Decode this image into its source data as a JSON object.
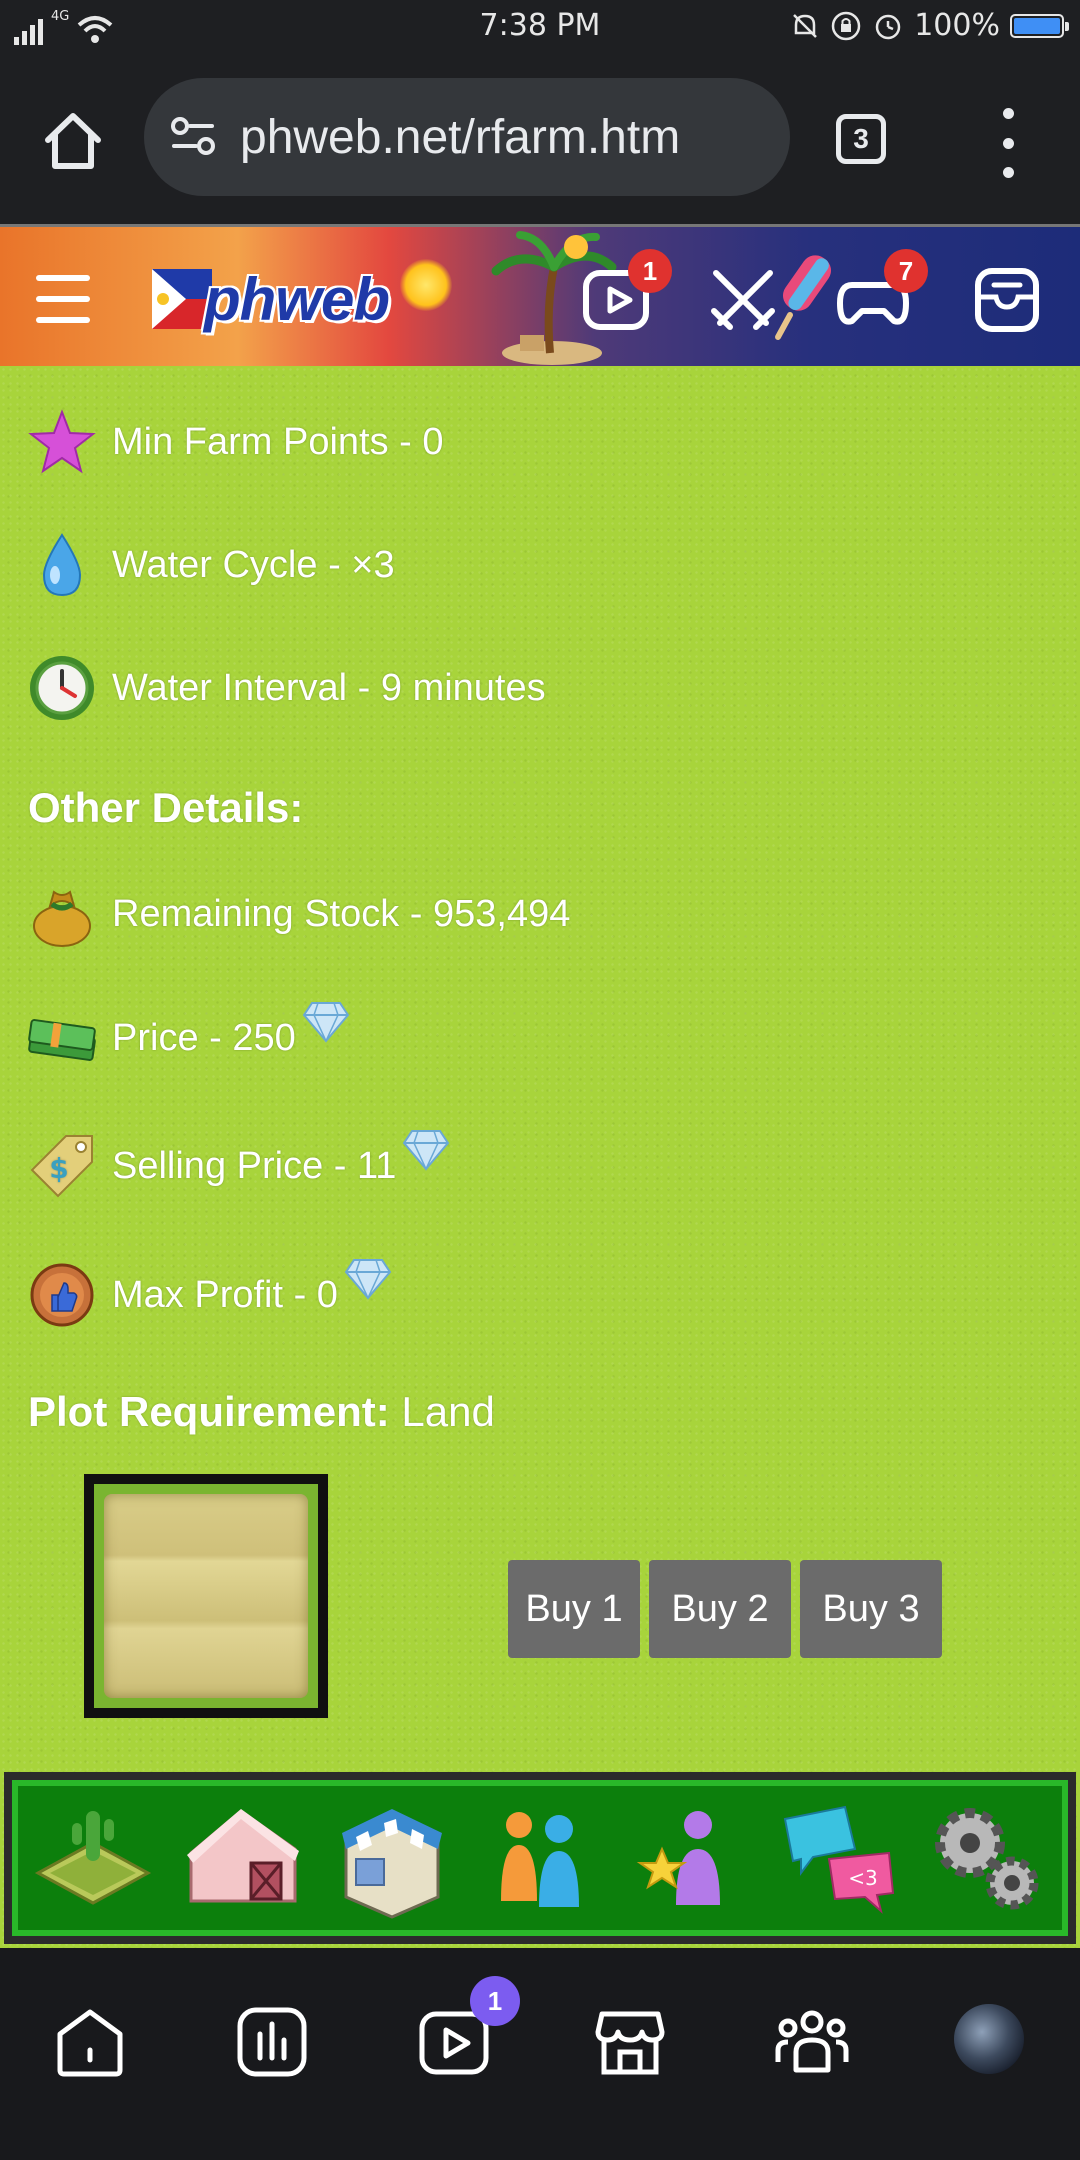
{
  "status_bar": {
    "network": "4G",
    "time": "7:38 PM",
    "battery_text": "100%",
    "battery_level": 1.0,
    "icons": [
      "signal-icon",
      "wifi-icon",
      "mute-icon",
      "lock-rotation-icon",
      "alarm-icon",
      "battery-icon"
    ]
  },
  "browser": {
    "url": "phweb.net/rfarm.htm",
    "tab_count": "3"
  },
  "site_header": {
    "logo_text": "phweb",
    "notifications": {
      "video_badge": "1",
      "game_badge": "7"
    }
  },
  "details": {
    "min_farm_points": "Min Farm Points - 0",
    "water_cycle": "Water Cycle - ×3",
    "water_interval": "Water Interval - 9 minutes",
    "other_heading": "Other Details:",
    "remaining_stock": "Remaining Stock - 953,494",
    "price": "Price - 250",
    "selling_price": "Selling Price - 11",
    "max_profit": "Max Profit - 0",
    "plot_label": "Plot Requirement:",
    "plot_value": " Land"
  },
  "buy_buttons": {
    "buy1": "Buy 1",
    "buy2": "Buy 2",
    "buy3": "Buy 3"
  },
  "game_nav": {
    "items": [
      "farm-field-icon",
      "barn-icon",
      "shop-icon",
      "friends-icon",
      "ranking-icon",
      "chat-icon",
      "settings-icon"
    ],
    "active_index": 2
  },
  "bottom_nav": {
    "items": [
      "home-icon",
      "stats-icon",
      "video-icon",
      "store-icon",
      "community-icon",
      "avatar"
    ],
    "video_badge": "1"
  },
  "colors": {
    "grass": "#a8d43b",
    "nav_green": "#0c7f0c",
    "nav_active": "#35c935",
    "button_gray": "#6b6b6b",
    "badge_red": "#e0322f",
    "badge_purple": "#7c5cf0"
  }
}
